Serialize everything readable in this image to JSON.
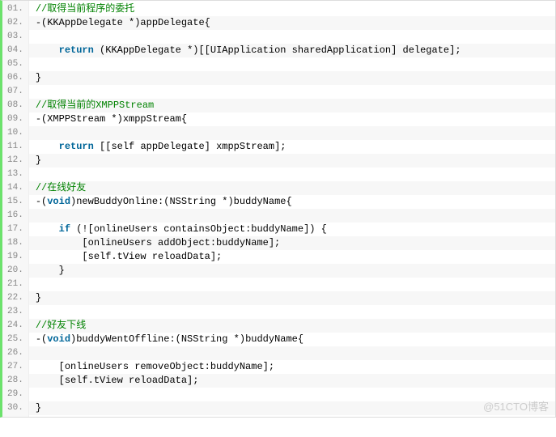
{
  "lines": [
    {
      "n": "01.",
      "segs": [
        {
          "cls": "c-comment",
          "t": "//取得当前程序的委托"
        }
      ]
    },
    {
      "n": "02.",
      "segs": [
        {
          "cls": "c-plain",
          "t": "-(KKAppDelegate *)appDelegate{"
        }
      ]
    },
    {
      "n": "03.",
      "segs": []
    },
    {
      "n": "04.",
      "segs": [
        {
          "cls": "c-plain",
          "t": "    "
        },
        {
          "cls": "c-keyword",
          "t": "return"
        },
        {
          "cls": "c-plain",
          "t": " (KKAppDelegate *)[[UIApplication sharedApplication] delegate];"
        }
      ]
    },
    {
      "n": "05.",
      "segs": []
    },
    {
      "n": "06.",
      "segs": [
        {
          "cls": "c-plain",
          "t": "}"
        }
      ]
    },
    {
      "n": "07.",
      "segs": []
    },
    {
      "n": "08.",
      "segs": [
        {
          "cls": "c-comment",
          "t": "//取得当前的XMPPStream"
        }
      ]
    },
    {
      "n": "09.",
      "segs": [
        {
          "cls": "c-plain",
          "t": "-(XMPPStream *)xmppStream{"
        }
      ]
    },
    {
      "n": "10.",
      "segs": []
    },
    {
      "n": "11.",
      "segs": [
        {
          "cls": "c-plain",
          "t": "    "
        },
        {
          "cls": "c-keyword",
          "t": "return"
        },
        {
          "cls": "c-plain",
          "t": " [[self appDelegate] xmppStream];"
        }
      ]
    },
    {
      "n": "12.",
      "segs": [
        {
          "cls": "c-plain",
          "t": "}"
        }
      ]
    },
    {
      "n": "13.",
      "segs": []
    },
    {
      "n": "14.",
      "segs": [
        {
          "cls": "c-comment",
          "t": "//在线好友"
        }
      ]
    },
    {
      "n": "15.",
      "segs": [
        {
          "cls": "c-plain",
          "t": "-("
        },
        {
          "cls": "c-keyword",
          "t": "void"
        },
        {
          "cls": "c-plain",
          "t": ")newBuddyOnline:(NSString *)buddyName{"
        }
      ]
    },
    {
      "n": "16.",
      "segs": []
    },
    {
      "n": "17.",
      "segs": [
        {
          "cls": "c-plain",
          "t": "    "
        },
        {
          "cls": "c-keyword",
          "t": "if"
        },
        {
          "cls": "c-plain",
          "t": " (![onlineUsers containsObject:buddyName]) {"
        }
      ]
    },
    {
      "n": "18.",
      "segs": [
        {
          "cls": "c-plain",
          "t": "        [onlineUsers addObject:buddyName];"
        }
      ]
    },
    {
      "n": "19.",
      "segs": [
        {
          "cls": "c-plain",
          "t": "        [self.tView reloadData];"
        }
      ]
    },
    {
      "n": "20.",
      "segs": [
        {
          "cls": "c-plain",
          "t": "    }"
        }
      ]
    },
    {
      "n": "21.",
      "segs": []
    },
    {
      "n": "22.",
      "segs": [
        {
          "cls": "c-plain",
          "t": "}"
        }
      ]
    },
    {
      "n": "23.",
      "segs": []
    },
    {
      "n": "24.",
      "segs": [
        {
          "cls": "c-comment",
          "t": "//好友下线"
        }
      ]
    },
    {
      "n": "25.",
      "segs": [
        {
          "cls": "c-plain",
          "t": "-("
        },
        {
          "cls": "c-keyword",
          "t": "void"
        },
        {
          "cls": "c-plain",
          "t": ")buddyWentOffline:(NSString *)buddyName{"
        }
      ]
    },
    {
      "n": "26.",
      "segs": []
    },
    {
      "n": "27.",
      "segs": [
        {
          "cls": "c-plain",
          "t": "    [onlineUsers removeObject:buddyName];"
        }
      ]
    },
    {
      "n": "28.",
      "segs": [
        {
          "cls": "c-plain",
          "t": "    [self.tView reloadData];"
        }
      ]
    },
    {
      "n": "29.",
      "segs": []
    },
    {
      "n": "30.",
      "segs": [
        {
          "cls": "c-plain",
          "t": "}"
        }
      ]
    }
  ],
  "watermark": "@51CTO博客"
}
